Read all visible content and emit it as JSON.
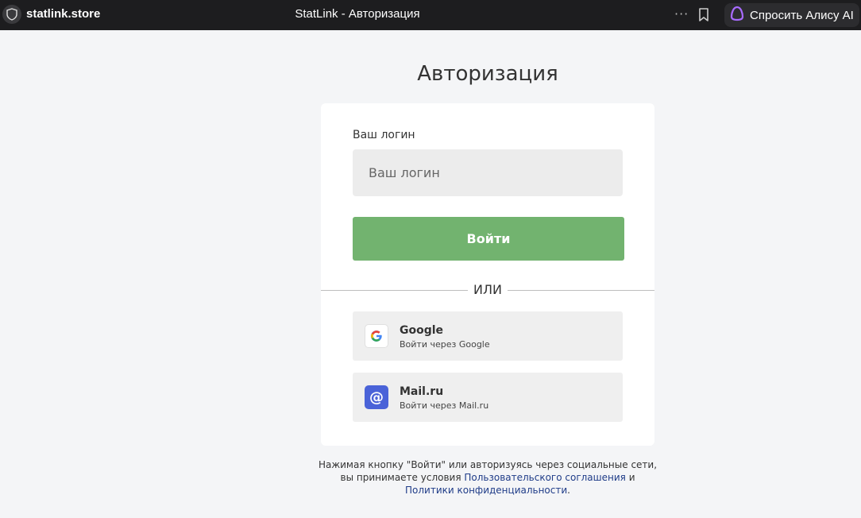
{
  "browser": {
    "site": "statlink.store",
    "tab_title": "StatLink - Авторизация",
    "menu_dots": "···",
    "alice_label": "Спросить Алису AI"
  },
  "page": {
    "heading": "Авторизация",
    "login_label": "Ваш логин",
    "login_placeholder": "Ваш логин",
    "login_value": "",
    "submit_label": "Войти",
    "or_text": "ИЛИ",
    "social": {
      "google": {
        "name": "Google",
        "subtitle": "Войти через Google",
        "icon": "G"
      },
      "mail": {
        "name": "Mail.ru",
        "subtitle": "Войти через Mail.ru",
        "icon": "@"
      }
    },
    "terms": {
      "line1": "Нажимая кнопку \"Войти\" или авторизуясь через социальные сети,",
      "line2_prefix": "вы принимаете условия ",
      "agreement_link": "Пользовательского соглашения",
      "and": " и",
      "privacy_link": "Политики конфиденциальности",
      "end": "."
    }
  },
  "colors": {
    "topbar_bg": "#1d1d1f",
    "page_bg": "#f4f5f7",
    "button_green": "#72b36f",
    "mail_blue": "#4a63d8",
    "link_blue": "#1f3c88",
    "alice_purple": "#a86bff"
  }
}
